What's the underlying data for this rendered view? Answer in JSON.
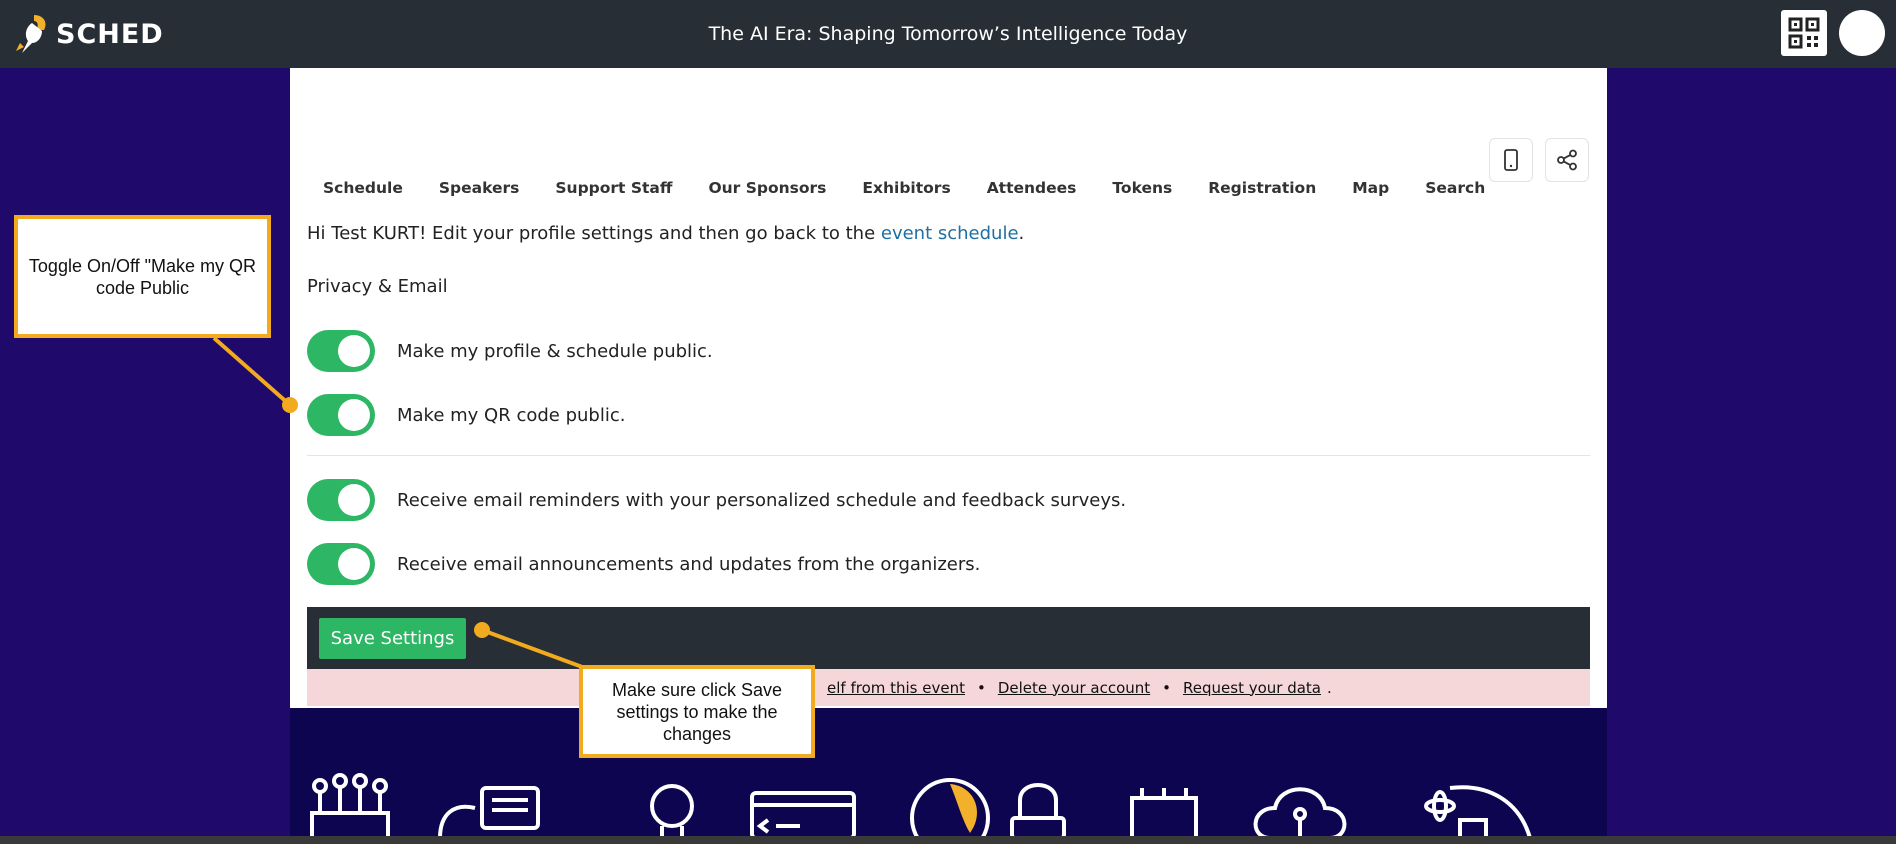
{
  "topbar": {
    "brand": "SCHED",
    "event_title": "The AI Era: Shaping Tomorrow’s Intelligence Today"
  },
  "nav": {
    "items": [
      "Schedule",
      "Speakers",
      "Support Staff",
      "Our Sponsors",
      "Exhibitors",
      "Attendees",
      "Tokens",
      "Registration",
      "Map",
      "Search"
    ]
  },
  "settings": {
    "greeting_prefix": "Hi Test KURT! Edit your profile settings and then go back to the ",
    "greeting_link": "event schedule",
    "greeting_suffix": ".",
    "section_title": "Privacy & Email",
    "toggles": [
      {
        "label": "Make my profile & schedule public.",
        "on": true
      },
      {
        "label": "Make my QR code public.",
        "on": true
      },
      {
        "label": "Receive email reminders with your personalized schedule and feedback surveys.",
        "on": true
      },
      {
        "label": "Receive email announcements and updates from the organizers.",
        "on": true
      }
    ],
    "save_label": "Save Settings",
    "account_links": {
      "remove": "elf from this event",
      "delete": "Delete your account",
      "request": "Request your data",
      "separator": "•",
      "end": "."
    }
  },
  "annotations": {
    "toggle_note": "Toggle On/Off \"Make my QR code Public",
    "save_note": "Make sure click Save settings to make the changes"
  },
  "colors": {
    "topbar": "#272e36",
    "background": "#1f0a6b",
    "toggle_on": "#2db664",
    "link": "#1f6fa3",
    "callout_border": "#f2aa1e"
  }
}
